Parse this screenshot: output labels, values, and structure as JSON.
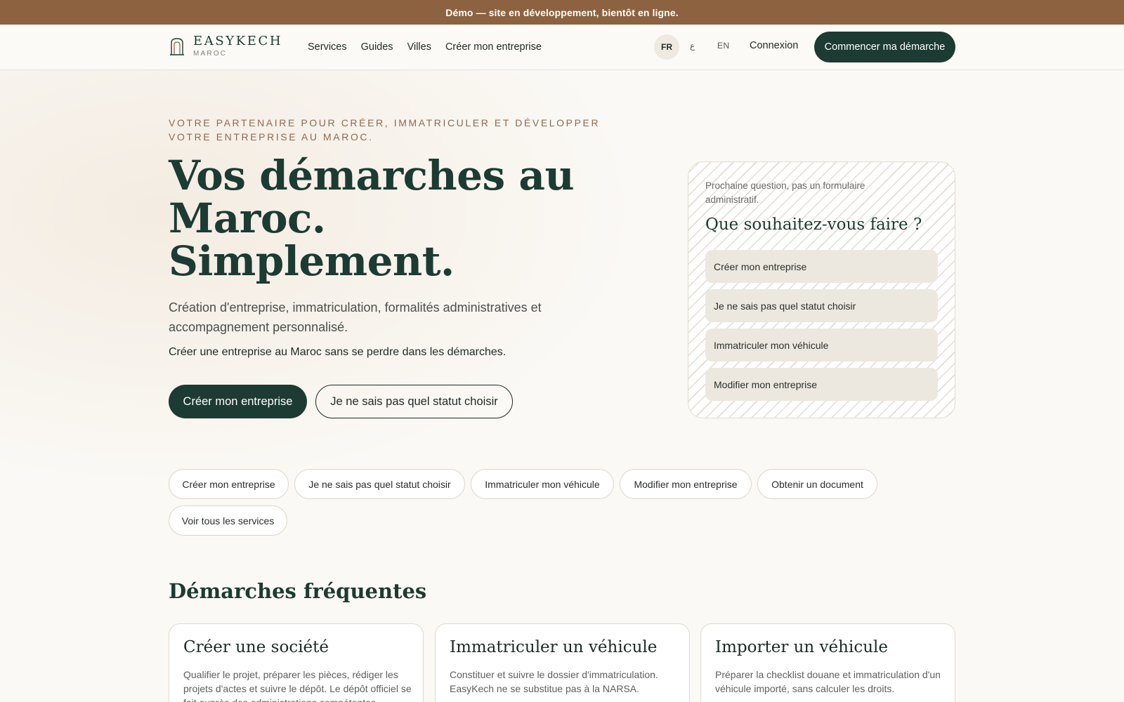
{
  "banner": {
    "text": "Démo — site en développement, bientôt en ligne."
  },
  "brand": {
    "name": "EASYKECH",
    "sub": "MAROC",
    "icon": "arch-door-icon"
  },
  "nav": {
    "links": [
      "Services",
      "Guides",
      "Villes",
      "Créer mon entreprise"
    ],
    "languages": {
      "active": "FR",
      "arabic": "ع",
      "english": "EN"
    },
    "login": "Connexion",
    "cta": "Commencer ma démarche"
  },
  "hero": {
    "eyebrow": "VOTRE PARTENAIRE POUR CRÉER, IMMATRICULER ET DÉVELOPPER VOTRE ENTREPRISE AU MAROC.",
    "title_lines": [
      "Vos démarches au",
      "Maroc.",
      "Simplement."
    ],
    "subtitle": "Création d'entreprise, immatriculation, formalités administratives et accompagnement personnalisé.",
    "note": "Créer une entreprise au Maroc sans se perdre dans les démarches.",
    "primary_button": "Créer mon entreprise",
    "secondary_button": "Je ne sais pas quel statut choisir"
  },
  "question_card": {
    "lead": "Prochaine question, pas un formulaire administratif.",
    "title": "Que souhaitez-vous faire ?",
    "options": [
      "Créer mon entreprise",
      "Je ne sais pas quel statut choisir",
      "Immatriculer mon véhicule",
      "Modifier mon entreprise"
    ]
  },
  "chips": [
    "Créer mon entreprise",
    "Je ne sais pas quel statut choisir",
    "Immatriculer mon véhicule",
    "Modifier mon entreprise",
    "Obtenir un document",
    "Voir tous les services"
  ],
  "frequent": {
    "title": "Démarches fréquentes",
    "cards": [
      {
        "title": "Créer une société",
        "desc": "Qualifier le projet, préparer les pièces, rédiger les projets d'actes et suivre le dépôt. Le dépôt officiel se fait auprès des administrations compétentes."
      },
      {
        "title": "Immatriculer un véhicule",
        "desc": "Constituer et suivre le dossier d'immatriculation. EasyKech ne se substitue pas à la NARSA."
      },
      {
        "title": "Importer un véhicule",
        "desc": "Préparer la checklist douane et immatriculation d'un véhicule importé, sans calculer les droits."
      }
    ]
  },
  "colors": {
    "banner": "#8c6240",
    "primary": "#1c3b32",
    "accent": "#8c6b52"
  }
}
